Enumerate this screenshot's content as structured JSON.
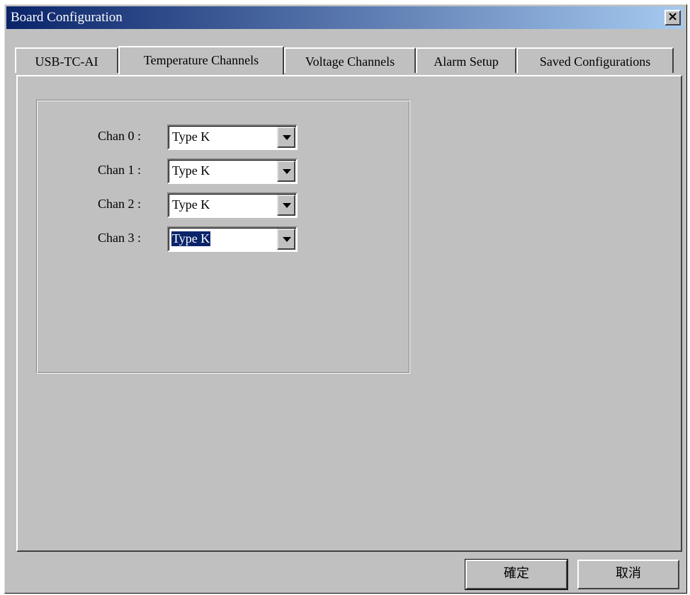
{
  "window": {
    "title": "Board Configuration",
    "close_glyph": "×"
  },
  "tabs": [
    {
      "label": "USB-TC-AI",
      "active": false
    },
    {
      "label": "Temperature Channels",
      "active": true
    },
    {
      "label": "Voltage Channels",
      "active": false
    },
    {
      "label": "Alarm Setup",
      "active": false
    },
    {
      "label": "Saved Configurations",
      "active": false
    }
  ],
  "channels": [
    {
      "label": "Chan 0 :",
      "value": "Type K",
      "selected": false
    },
    {
      "label": "Chan 1 :",
      "value": "Type K",
      "selected": false
    },
    {
      "label": "Chan 2 :",
      "value": "Type K",
      "selected": false
    },
    {
      "label": "Chan 3 :",
      "value": "Type K",
      "selected": true
    }
  ],
  "buttons": {
    "ok_label": "確定",
    "cancel_label": "取消"
  },
  "colors": {
    "titlebar_start": "#0a246a",
    "titlebar_end": "#a6caf0",
    "face": "#c0c0c0",
    "selection": "#0a246a"
  }
}
